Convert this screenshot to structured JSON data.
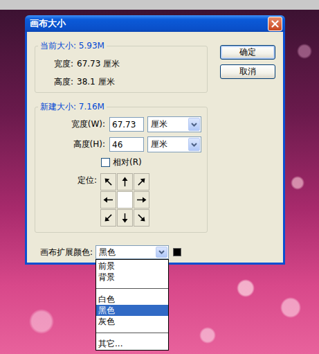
{
  "window": {
    "title": "画布大小"
  },
  "current_size": {
    "title": "当前大小: 5.93M",
    "rows": [
      {
        "label": "宽度:",
        "value": "67.73 厘米"
      },
      {
        "label": "高度:",
        "value": "38.1 厘米"
      }
    ]
  },
  "new_size": {
    "title": "新建大小: 7.16M",
    "fields": [
      {
        "label": "宽度(W):",
        "value": "67.73",
        "unit": "厘米"
      },
      {
        "label": "高度(H):",
        "value": "46",
        "unit": "厘米"
      }
    ],
    "relative": {
      "label": "相对(R)",
      "checked": false
    },
    "anchor": {
      "label": "定位:",
      "cells": [
        {
          "selected": false
        },
        {
          "selected": false
        },
        {
          "selected": false
        },
        {
          "selected": false
        },
        {
          "selected": true
        },
        {
          "selected": false
        },
        {
          "selected": false
        },
        {
          "selected": false
        },
        {
          "selected": false
        }
      ]
    }
  },
  "buttons": [
    {
      "label": "确定",
      "default": true
    },
    {
      "label": "取消",
      "default": false
    }
  ],
  "extension_color": {
    "label": "画布扩展颜色:",
    "value": "黑色",
    "color": "#000000",
    "open": true,
    "options": [
      {
        "kind": "option",
        "label": "前景",
        "selected": false
      },
      {
        "kind": "option",
        "label": "背景",
        "selected": false
      },
      {
        "kind": "separator",
        "selected": false
      },
      {
        "kind": "option",
        "label": "白色",
        "selected": false
      },
      {
        "kind": "option",
        "label": "黑色",
        "selected": true
      },
      {
        "kind": "option",
        "label": "灰色",
        "selected": false
      },
      {
        "kind": "separator",
        "selected": false
      },
      {
        "kind": "option",
        "label": "其它...",
        "selected": false
      }
    ]
  }
}
